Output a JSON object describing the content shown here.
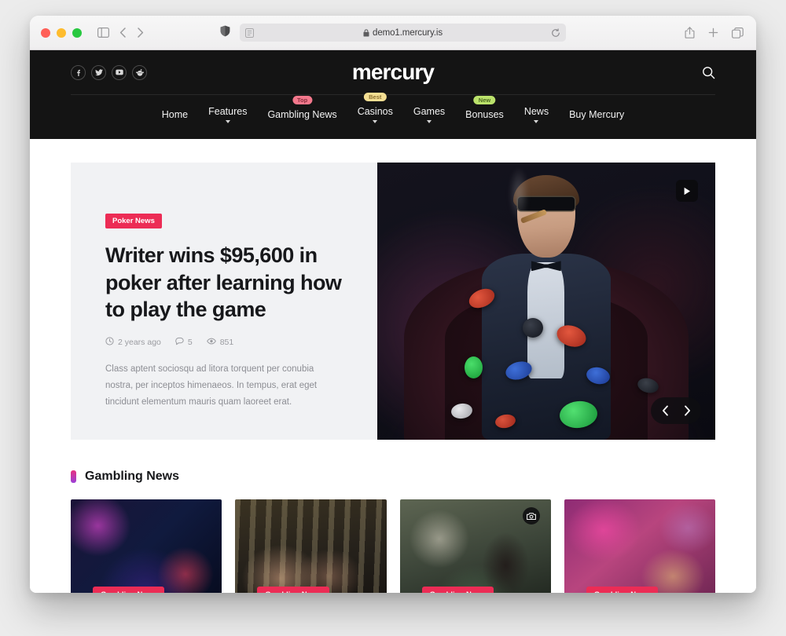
{
  "browser": {
    "url": "demo1.mercury.is",
    "traffic_lights": [
      "close",
      "minimize",
      "zoom"
    ],
    "toolbar_icons": [
      "sidebar-icon",
      "back-icon",
      "forward-icon",
      "shield-icon",
      "reader-icon",
      "lock-icon",
      "reload-icon",
      "share-icon",
      "new-tab-icon",
      "tab-overview-icon"
    ]
  },
  "site": {
    "logo": "mercury",
    "socials": [
      {
        "name": "facebook",
        "glyph": "f"
      },
      {
        "name": "twitter",
        "glyph": "t"
      },
      {
        "name": "youtube",
        "glyph": "y"
      },
      {
        "name": "reddit",
        "glyph": "r"
      }
    ],
    "search_label": "Search",
    "nav": [
      {
        "label": "Home",
        "caret": false,
        "badge": null
      },
      {
        "label": "Features",
        "caret": true,
        "badge": null
      },
      {
        "label": "Gambling News",
        "caret": false,
        "badge": "Top",
        "badge_type": "top"
      },
      {
        "label": "Casinos",
        "caret": true,
        "badge": "Best",
        "badge_type": "best"
      },
      {
        "label": "Games",
        "caret": true,
        "badge": null
      },
      {
        "label": "Bonuses",
        "caret": false,
        "badge": "New",
        "badge_type": "new"
      },
      {
        "label": "News",
        "caret": true,
        "badge": null
      },
      {
        "label": "Buy Mercury",
        "caret": false,
        "badge": null
      }
    ]
  },
  "hero": {
    "category": "Poker News",
    "title": "Writer wins $95,600 in poker after learning how to play the game",
    "meta": {
      "time": "2 years ago",
      "comments": "5",
      "views": "851"
    },
    "excerpt": "Class aptent sociosqu ad litora torquent per conubia nostra, per inceptos himenaeos. In tempus, erat eget tincidunt elementum mauris quam laoreet erat.",
    "media_alt": "Man in tuxedo with sunglasses smoking a cigar surrounded by flying poker chips",
    "play_label": "Play",
    "prev_label": "Previous",
    "next_label": "Next"
  },
  "section": {
    "title": "Gambling News",
    "accent_start": "#e8317f",
    "accent_end": "#9b3fd8"
  },
  "cards": [
    {
      "badge": "Gambling News",
      "alt": "Casino lights and dice blur",
      "gallery": false
    },
    {
      "badge": "Gambling News",
      "alt": "Couple playing slot machines",
      "gallery": false
    },
    {
      "badge": "Gambling News",
      "alt": "Woman smiling in casino",
      "gallery": true
    },
    {
      "badge": "Gambling News",
      "alt": "Fabulous Las Vegas sign with cards",
      "gallery": false
    }
  ],
  "colors": {
    "header_bg": "#141414",
    "badge_red": "#ec2c55",
    "hero_panel": "#f1f2f4"
  }
}
